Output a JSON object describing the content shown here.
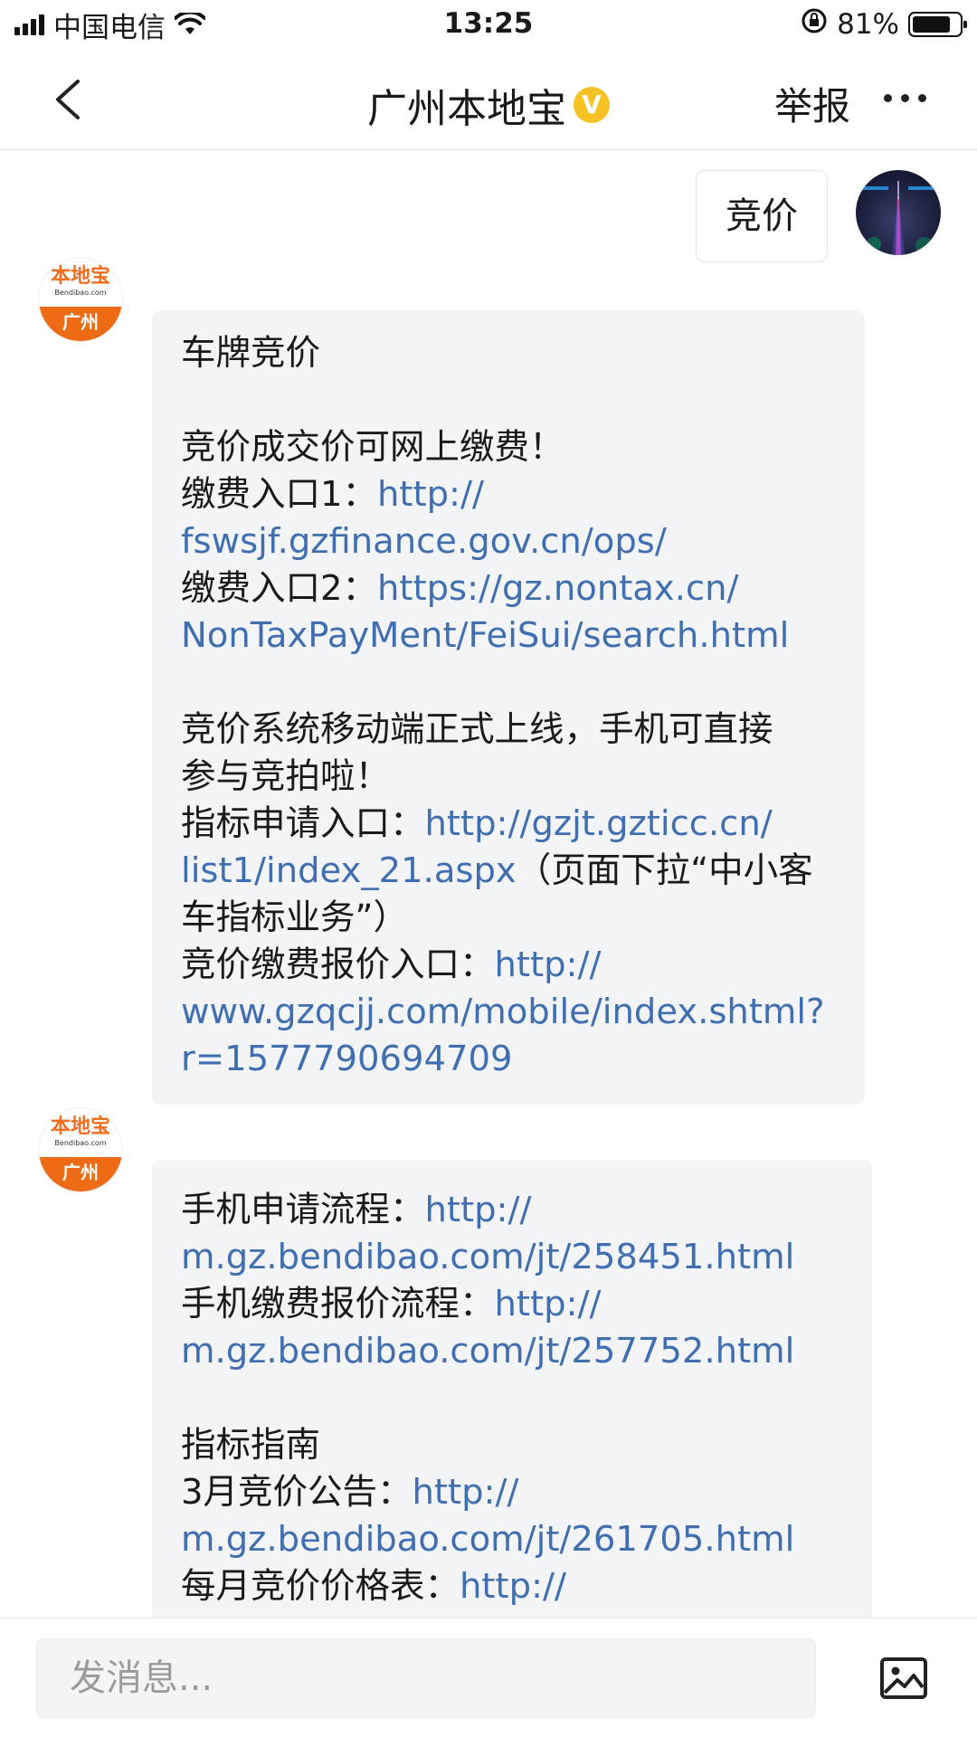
{
  "status_bar": {
    "carrier": "中国电信",
    "time": "13:25",
    "battery_percent": "81%",
    "battery_level": 0.81
  },
  "nav": {
    "title": "广州本地宝",
    "verified_badge": "V",
    "report": "举报"
  },
  "sent": {
    "text": "竞价"
  },
  "bot_avatar": {
    "top": "本地宝",
    "sub": "Bendibao.com",
    "bottom": "广州"
  },
  "msg1": {
    "l1": "车牌竞价",
    "l2": "竞价成交价可网上缴费！",
    "l3a": "缴费入口1：",
    "l3b": "http://",
    "l4": "fswsjf.gzfinance.gov.cn/ops/",
    "l5a": "缴费入口2：",
    "l5b": "https://gz.nontax.cn/",
    "l6": "NonTaxPayMent/FeiSui/search.html",
    "l7": "竞价系统移动端正式上线，手机可直接",
    "l8": "参与竞拍啦！",
    "l9a": "指标申请入口：",
    "l9b": "http://gzjt.gzticc.cn/",
    "l10a": "list1/index_21.aspx",
    "l10b": "（页面下拉“中小客",
    "l11": "车指标业务”）",
    "l12a": "竞价缴费报价入口：",
    "l12b": "http://",
    "l13": "www.gzqcjj.com/mobile/index.shtml?",
    "l14": "r=1577790694709"
  },
  "msg2": {
    "l1a": "手机申请流程：",
    "l1b": "http://",
    "l2": "m.gz.bendibao.com/jt/258451.html",
    "l3a": "手机缴费报价流程：",
    "l3b": "http://",
    "l4": "m.gz.bendibao.com/jt/257752.html",
    "l5": "指标指南",
    "l6a": "3月竞价公告：",
    "l6b": "http://",
    "l7": "m.gz.bendibao.com/jt/261705.html",
    "l8a": "每月竞价价格表：",
    "l8b": "http://"
  },
  "input": {
    "placeholder": "发消息..."
  },
  "colors": {
    "link": "#3f6fb0",
    "bubble": "#f3f4f6",
    "brand_orange": "#ee6b16",
    "verified": "#f6c223"
  }
}
